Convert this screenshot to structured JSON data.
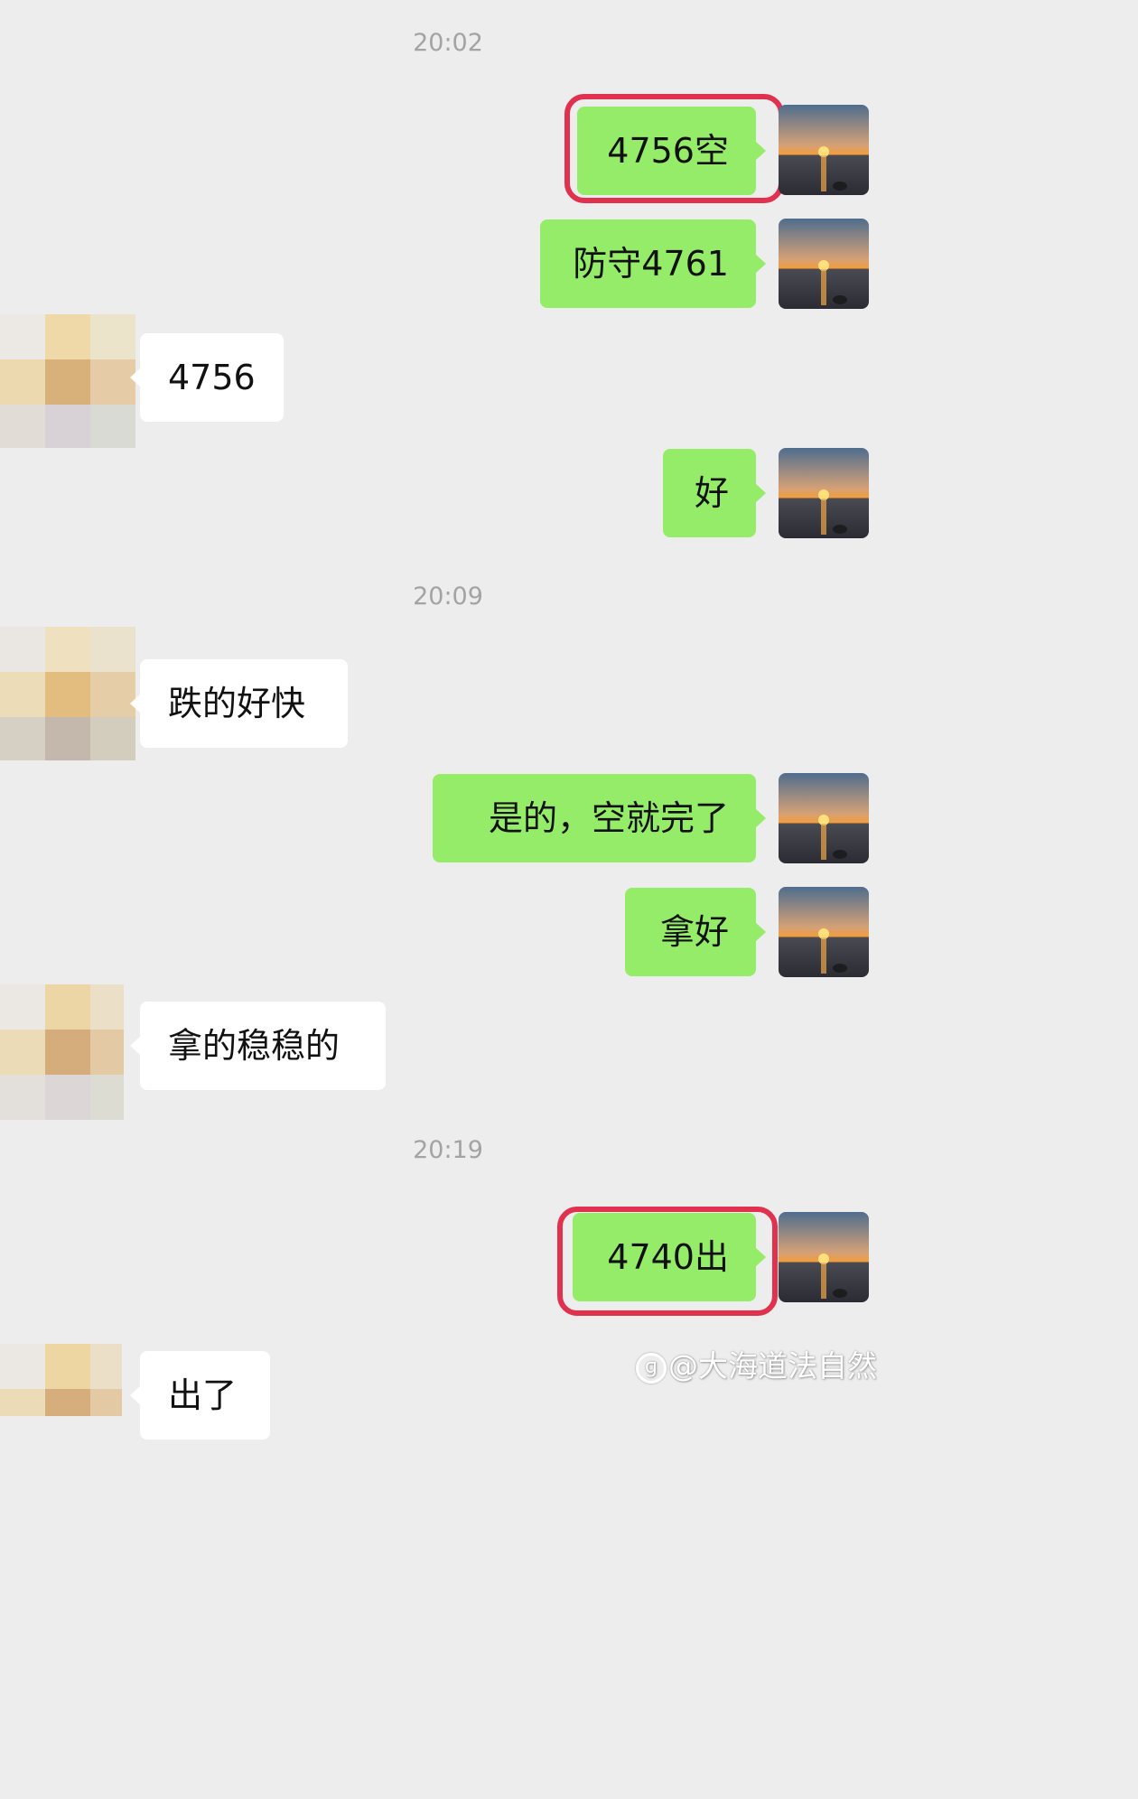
{
  "chat": {
    "time_1": "20:02",
    "time_2": "20:09",
    "time_3": "20:19",
    "messages": [
      {
        "sender": "me",
        "text": "4756空",
        "highlighted": true
      },
      {
        "sender": "me",
        "text": "防守4761",
        "highlighted": false
      },
      {
        "sender": "them",
        "text": "4756",
        "highlighted": false
      },
      {
        "sender": "me",
        "text": "好",
        "highlighted": false
      },
      {
        "sender": "them",
        "text": "跌的好快",
        "highlighted": false
      },
      {
        "sender": "me",
        "text": "是的，空就完了",
        "highlighted": false
      },
      {
        "sender": "me",
        "text": "拿好",
        "highlighted": false
      },
      {
        "sender": "them",
        "text": "拿的稳稳的",
        "highlighted": false
      },
      {
        "sender": "me",
        "text": "4740出",
        "highlighted": true
      },
      {
        "sender": "them",
        "text": "出了",
        "highlighted": false
      }
    ]
  },
  "watermark": {
    "icon": "weibo-logo-icon",
    "text": "@大海道法自然"
  },
  "colors": {
    "background": "#ededed",
    "my_bubble": "#95ec69",
    "their_bubble": "#ffffff",
    "highlight_box": "#e0324e",
    "timestamp": "#a3a3a3"
  },
  "avatars": {
    "me": "sunset-over-sea-avatar",
    "them": "pixelated-avatar"
  }
}
